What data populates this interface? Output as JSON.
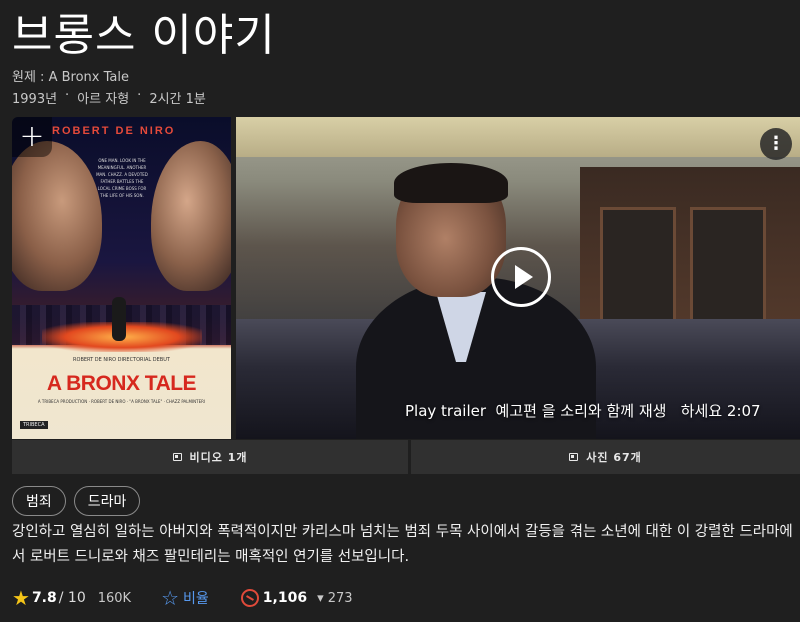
{
  "title": "브롱스 이야기",
  "original_title": "원제 : A Bronx Tale",
  "meta": {
    "year": "1993년",
    "rating": "아르 자형",
    "runtime": "2시간 1분",
    "separator": "·"
  },
  "poster": {
    "banner": "ROBERT DE NIRO",
    "tagline": "ONE MAN. LOOK IN THE MEANINGFUL. ANOTHER MAN. CHAZZ. A DEVOTED FATHER BATTLES THE LOCAL CRIME BOSS FOR THE LIFE OF HIS SON.",
    "small_credit": "ROBERT DE NIRO DIRECTORIAL DEBUT",
    "big_title": "A BRONX TALE",
    "credits": "A TRIBECA PRODUCTION · ROBERT DE NIRO · \"A BRONX TALE\" · CHAZZ PALMINTERI",
    "studio": "TRIBECA",
    "add_label": "+"
  },
  "video": {
    "trailer_text": "Play trailer  예고편 을 소리와 함께 재생   하세요 2:07",
    "more_label": "⋮"
  },
  "media": {
    "videos_label": "비디오 1개",
    "photos_label": "사진 67개"
  },
  "genres": [
    "범죄",
    "드라마"
  ],
  "description": "강인하고 열심히 일하는 아버지와 폭력적이지만 카리스마 넘치는 범죄 두목 사이에서 갈등을 겪는 소년에 대한 이 강렬한 드라마에서 로버트 드니로와 채즈 팔민테리는 매혹적인 연기를 선보입니다.",
  "ratings": {
    "imdb_value": "7.8",
    "imdb_max": "/ 10",
    "imdb_count": "160K",
    "rate_label": "비율",
    "popularity": "1,106",
    "popularity_delta": "▾ 273"
  },
  "colors": {
    "background": "#1f1f1f",
    "star": "#f5c518",
    "link": "#5799ef",
    "popularity": "#e04a3a"
  }
}
